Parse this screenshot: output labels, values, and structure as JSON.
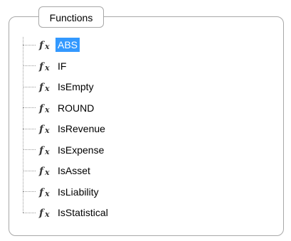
{
  "group": {
    "title": "Functions"
  },
  "tree": {
    "selected_index": 0,
    "items": [
      {
        "label": "ABS",
        "icon": "function-fx-icon"
      },
      {
        "label": "IF",
        "icon": "function-fx-icon"
      },
      {
        "label": "IsEmpty",
        "icon": "function-fx-icon"
      },
      {
        "label": "ROUND",
        "icon": "function-fx-icon"
      },
      {
        "label": "IsRevenue",
        "icon": "function-fx-icon"
      },
      {
        "label": "IsExpense",
        "icon": "function-fx-icon"
      },
      {
        "label": "IsAsset",
        "icon": "function-fx-icon"
      },
      {
        "label": "IsLiability",
        "icon": "function-fx-icon"
      },
      {
        "label": "IsStatistical",
        "icon": "function-fx-icon"
      }
    ]
  },
  "colors": {
    "selection": "#3399ff",
    "border": "#a8a8a8"
  }
}
